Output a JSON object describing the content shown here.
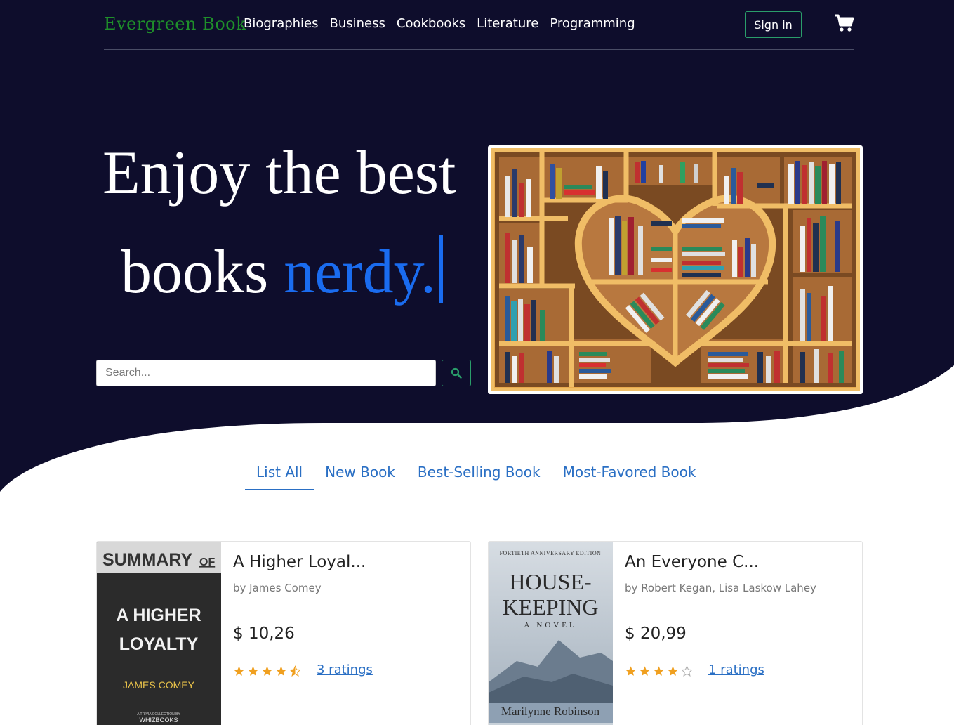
{
  "nav": {
    "brand": "Evergreen Book",
    "links": [
      "Biographies",
      "Business",
      "Cookbooks",
      "Literature",
      "Programming"
    ],
    "signin_label": "Sign in"
  },
  "hero": {
    "line1": "Enjoy the best",
    "line2_plain": "books",
    "line2_accent": "nerdy."
  },
  "search": {
    "placeholder": "Search...",
    "value": ""
  },
  "tabs": [
    {
      "label": "List All",
      "active": true
    },
    {
      "label": "New Book",
      "active": false
    },
    {
      "label": "Best-Selling Book",
      "active": false
    },
    {
      "label": "Most-Favored Book",
      "active": false
    }
  ],
  "books": [
    {
      "title": "A Higher Loyal...",
      "author": "by James Comey",
      "price": "$ 10,26",
      "rating": 4.5,
      "ratings_label": "3 ratings",
      "cover": {
        "top": "SUMMARY",
        "of": "OF",
        "line1": "A HIGHER",
        "line2": "LOYALTY",
        "author": "JAMES COMEY",
        "small1": "A TRIVIA COLLECTION BY",
        "publisher": "WHIZBOOKS"
      }
    },
    {
      "title": "An Everyone C...",
      "author": "by Robert Kegan, Lisa Laskow Lahey",
      "price": "$ 20,99",
      "rating": 4,
      "ratings_label": "1 ratings",
      "cover": {
        "edition": "FORTIETH ANNIVERSARY EDITION",
        "line1": "HOUSE-",
        "line2": "KEEPING",
        "sub": "A NOVEL",
        "author": "Marilynne Robinson"
      }
    }
  ],
  "colors": {
    "hero_bg": "#0e0d2c",
    "brand": "#1f8f2a",
    "accent": "#1a6cf0",
    "link": "#2a6fc4",
    "button_border": "#2a9d6a"
  }
}
